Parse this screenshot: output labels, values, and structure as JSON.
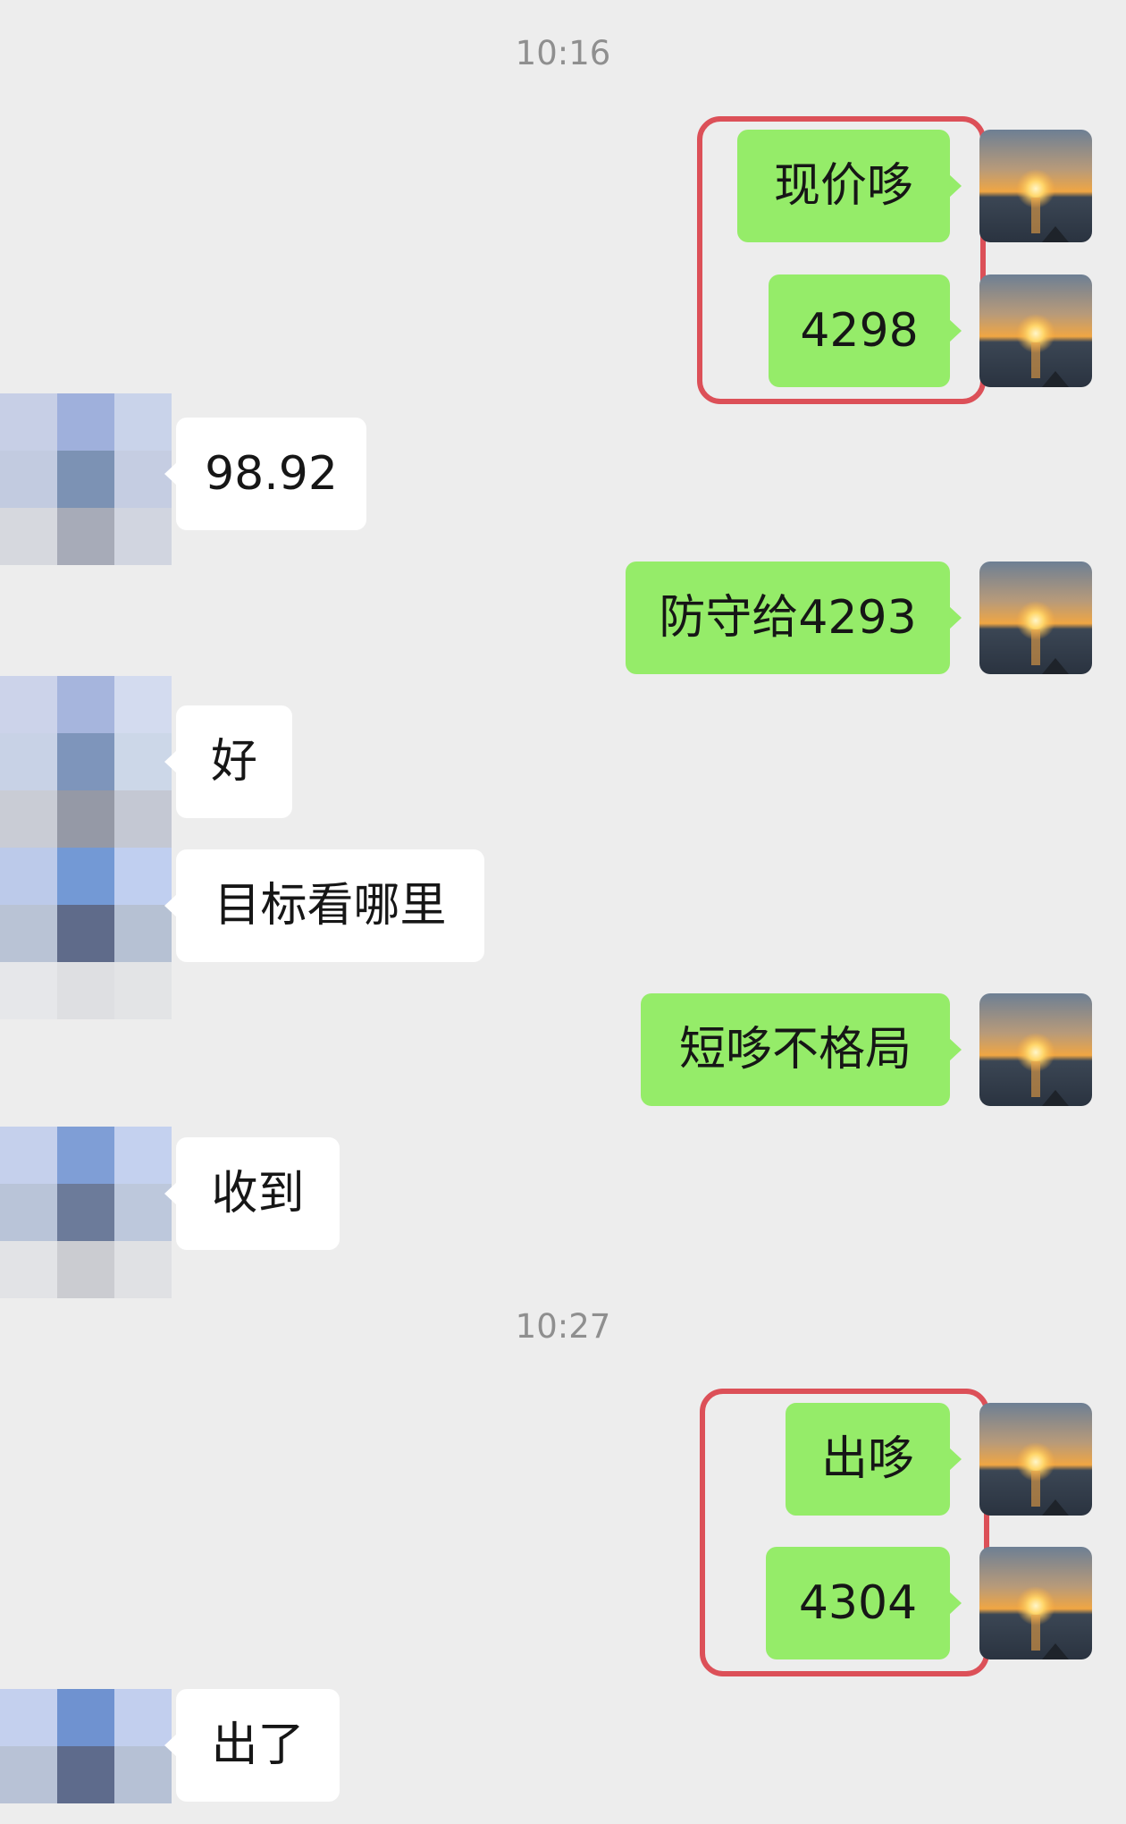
{
  "timestamps": [
    "10:16",
    "10:27"
  ],
  "messages": [
    {
      "side": "right",
      "text": "现价哆"
    },
    {
      "side": "right",
      "text": "4298"
    },
    {
      "side": "left",
      "text": "98.92"
    },
    {
      "side": "right",
      "text": "防守给4293"
    },
    {
      "side": "left",
      "text": "好"
    },
    {
      "side": "left",
      "text": "目标看哪里"
    },
    {
      "side": "right",
      "text": "短哆不格局"
    },
    {
      "side": "left",
      "text": "收到"
    },
    {
      "side": "right",
      "text": "出哆"
    },
    {
      "side": "right",
      "text": "4304"
    },
    {
      "side": "left",
      "text": "出了"
    }
  ],
  "colors": {
    "background": "#ededed",
    "bubble_sent": "#95ec69",
    "bubble_received": "#ffffff",
    "highlight_box": "#dc5058"
  },
  "icons": {
    "my_avatar": "sunset-over-sea-avatar",
    "contact_avatar": "pixelated-blurred-avatar"
  }
}
